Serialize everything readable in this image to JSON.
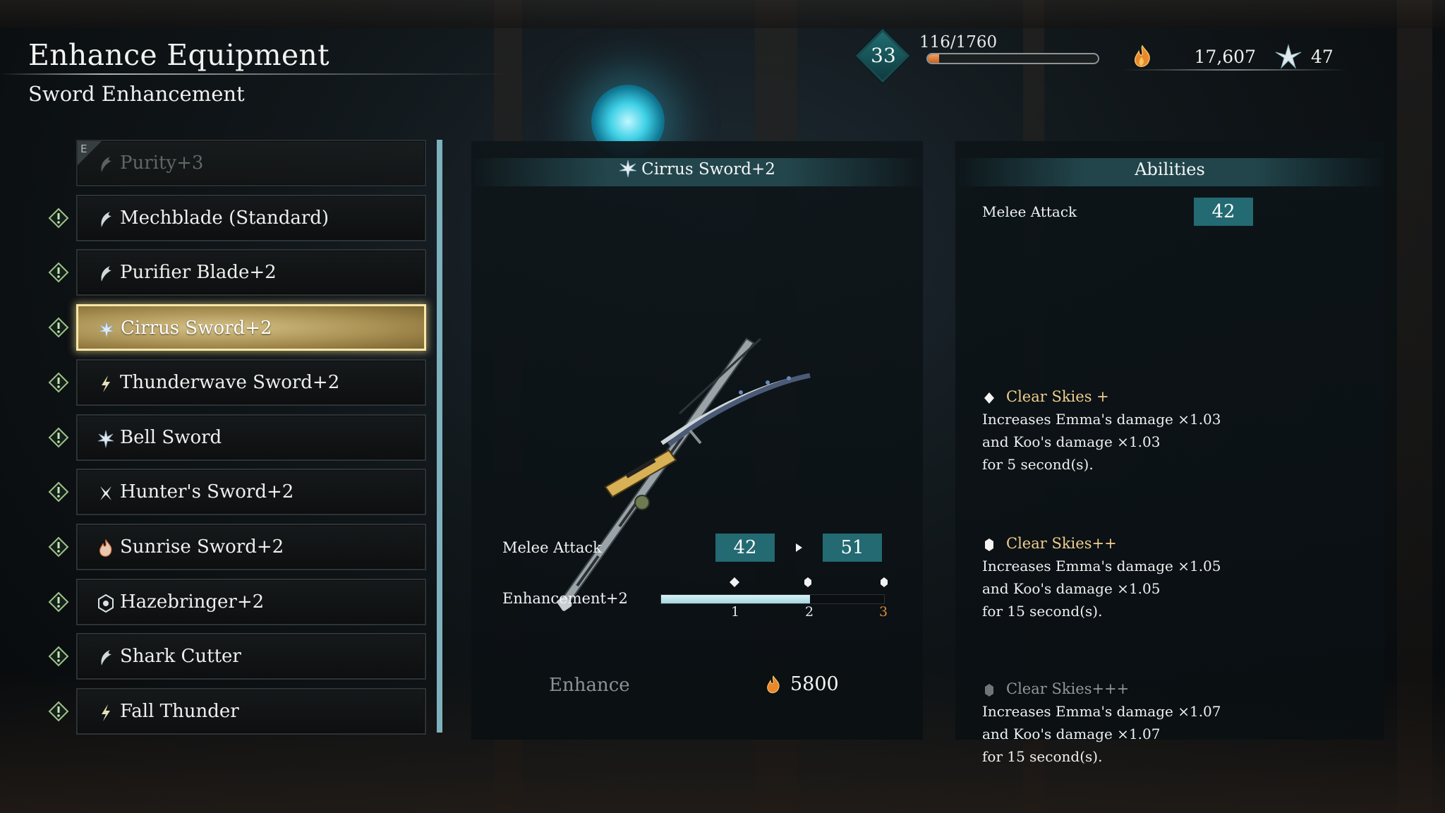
{
  "header": {
    "title": "Enhance Equipment",
    "subtitle": "Sword Enhancement"
  },
  "status": {
    "level": "33",
    "xp": "116/1760",
    "xp_progress": 0.066,
    "currency": "17,607",
    "currency_icon": "ember-icon",
    "shards": "47",
    "shards_icon": "shard-icon"
  },
  "weapon_list": [
    {
      "label": "Purity+3",
      "icon": "crescent-icon",
      "state": "equipped",
      "tag": "E"
    },
    {
      "label": "Mechblade (Standard)",
      "icon": "crescent-icon"
    },
    {
      "label": "Purifier Blade+2",
      "icon": "crescent-icon"
    },
    {
      "label": "Cirrus Sword+2",
      "icon": "frost-star-icon",
      "state": "selected"
    },
    {
      "label": "Thunderwave Sword+2",
      "icon": "lightning-icon"
    },
    {
      "label": "Bell Sword",
      "icon": "frost-star-icon"
    },
    {
      "label": "Hunter's Sword+2",
      "icon": "cross-star-icon"
    },
    {
      "label": "Sunrise Sword+2",
      "icon": "flame-icon"
    },
    {
      "label": "Hazebringer+2",
      "icon": "hexagon-icon"
    },
    {
      "label": "Shark Cutter",
      "icon": "crescent-icon"
    },
    {
      "label": "Fall Thunder",
      "icon": "lightning-icon"
    }
  ],
  "detail": {
    "weapon_name": "Cirrus Sword+2",
    "melee_label": "Melee Attack",
    "melee_current": "42",
    "melee_next": "51",
    "enhancement_label": "Enhancement+2",
    "enhancement_level": 2,
    "enhancement_max": 3,
    "ticks": [
      "1",
      "2",
      "3"
    ],
    "enhance_button": "Enhance",
    "enhance_cost": "5800"
  },
  "abilities": {
    "title": "Abilities",
    "melee_label": "Melee Attack",
    "melee_value": "42",
    "list": [
      {
        "name": "Clear Skies +",
        "lines": [
          "Increases Emma's damage ×1.03",
          "and Koo's damage ×1.03",
          "for 5 second(s)."
        ],
        "unlocked": true
      },
      {
        "name": "Clear Skies++",
        "lines": [
          "Increases Emma's damage ×1.05",
          "and Koo's damage ×1.05",
          "for 15 second(s)."
        ],
        "unlocked": true
      },
      {
        "name": "Clear Skies+++",
        "lines": [
          "Increases Emma's damage ×1.07",
          "and Koo's damage ×1.07",
          "for 15 second(s)."
        ],
        "unlocked": false
      }
    ]
  },
  "colors": {
    "accent_teal": "#236a72",
    "selected_gold": "#d6c287",
    "ability_name": "#f0ce8c",
    "xp_fill": "#e07a35"
  }
}
